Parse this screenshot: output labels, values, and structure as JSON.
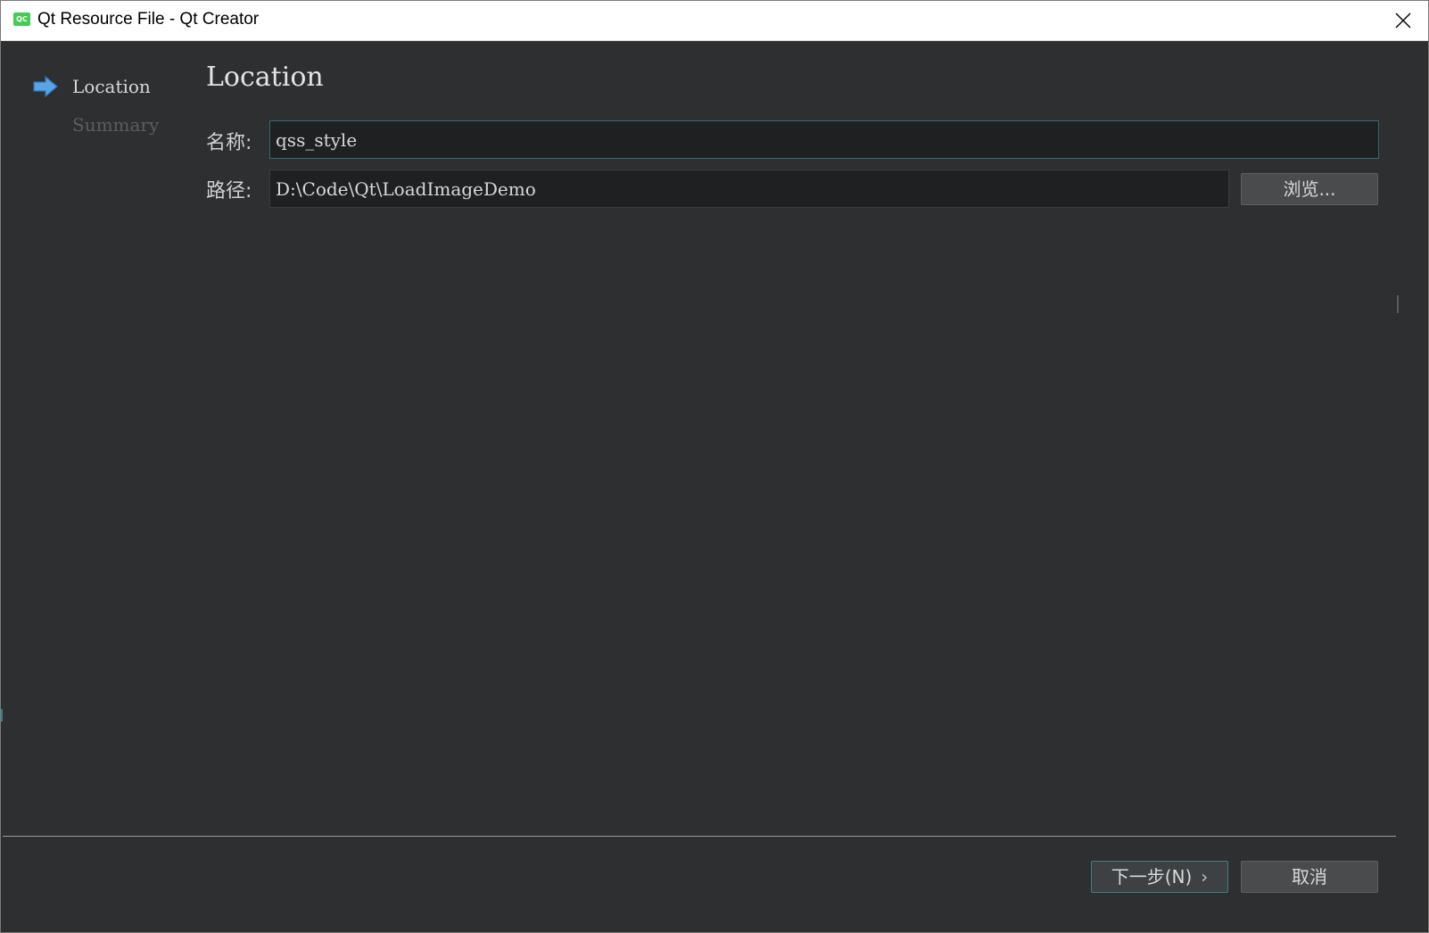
{
  "window": {
    "title": "Qt Resource File - Qt Creator",
    "app_icon_text": "QC"
  },
  "sidebar": {
    "steps": [
      {
        "label": "Location",
        "active": true
      },
      {
        "label": "Summary",
        "active": false
      }
    ]
  },
  "main": {
    "title": "Location",
    "name_label": "名称:",
    "name_value": "qss_style",
    "path_label": "路径:",
    "path_value": "D:\\Code\\Qt\\LoadImageDemo",
    "browse_label": "浏览..."
  },
  "footer": {
    "next_label": "下一步(N)",
    "next_chevron": "›",
    "cancel_label": "取消"
  },
  "colors": {
    "background": "#2e2f30",
    "input_focus_border": "#2f6a73",
    "active_arrow": "#5aa3e6"
  }
}
